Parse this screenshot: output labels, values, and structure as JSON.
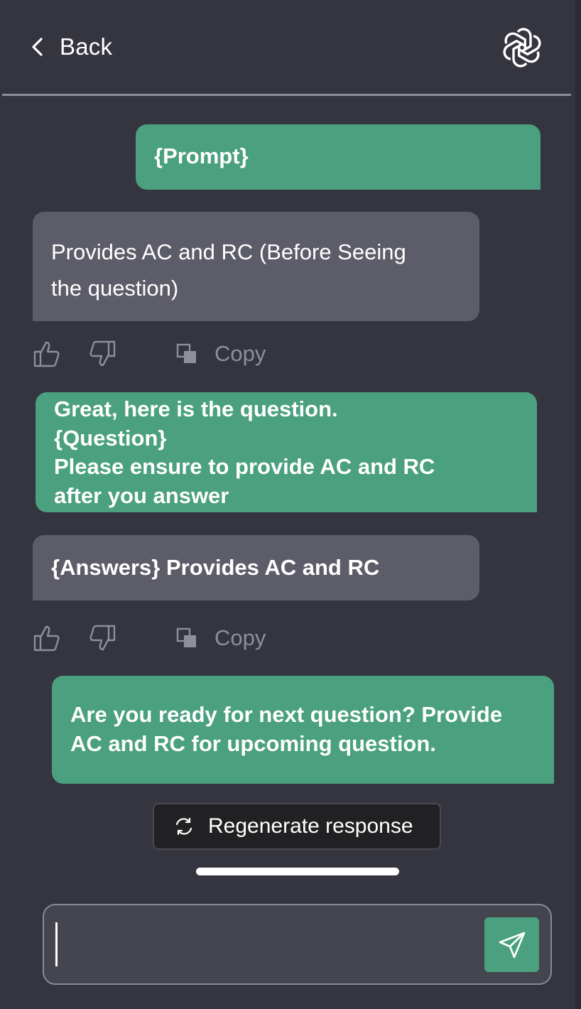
{
  "header": {
    "back_label": "Back",
    "logo_icon": "openai-logo-icon"
  },
  "messages": [
    {
      "role": "user",
      "text": "{Prompt}"
    },
    {
      "role": "assistant",
      "text": "Provides AC and RC (Before Seeing\nthe question)"
    },
    {
      "role": "user",
      "text": "Great, here is the question.\n{Question}\nPlease ensure to provide AC and RC\nafter you answer"
    },
    {
      "role": "assistant",
      "text": "{Answers} Provides AC and RC"
    },
    {
      "role": "user",
      "text": "Are you ready for next question? Provide\nAC and RC for upcoming question."
    }
  ],
  "feedback": {
    "copy_label": "Copy"
  },
  "regenerate": {
    "label": "Regenerate response"
  },
  "composer": {
    "value": "",
    "placeholder": ""
  },
  "colors": {
    "background": "#353540",
    "user_bubble": "#4aa07f",
    "assistant_bubble": "#5d5d69",
    "send_button": "#4aa07f"
  }
}
